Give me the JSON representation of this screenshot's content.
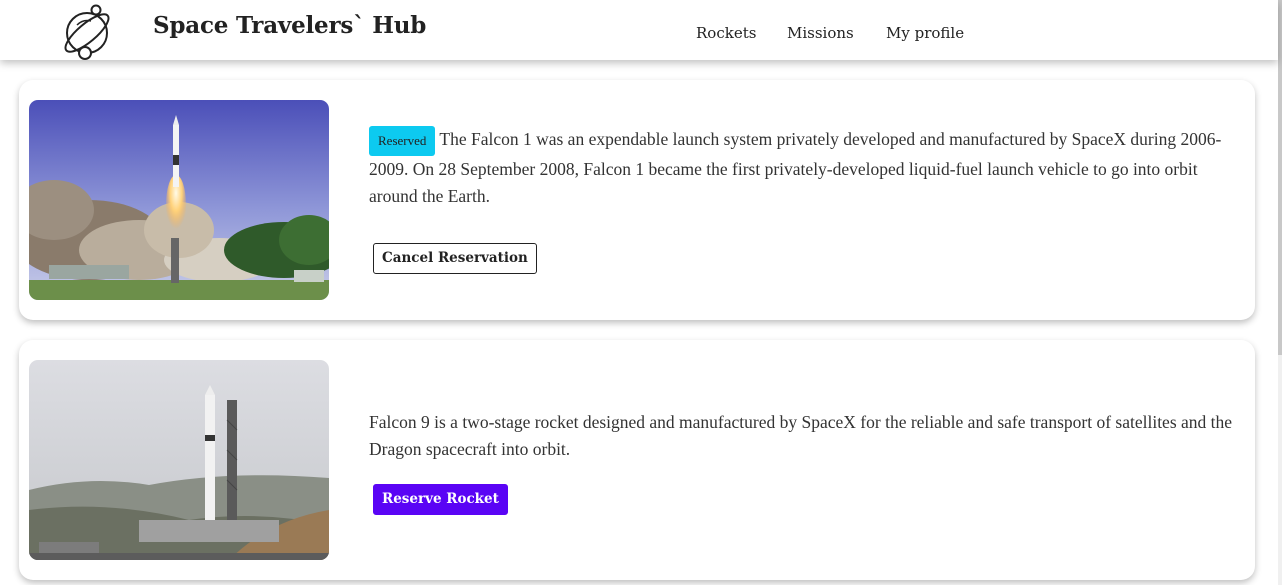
{
  "header": {
    "brand": "Space Travelers` Hub",
    "logo_icon": "planet-logo-icon",
    "nav": [
      {
        "label": "Rockets"
      },
      {
        "label": "Missions"
      },
      {
        "label": "My profile"
      }
    ]
  },
  "rockets": [
    {
      "image": "falcon-1-launch-image",
      "reserved": true,
      "badge": "Reserved",
      "description": "The Falcon 1 was an expendable launch system privately developed and manufactured by SpaceX during 2006-2009. On 28 September 2008, Falcon 1 became the first privately-developed liquid-fuel launch vehicle to go into orbit around the Earth.",
      "button": "Cancel Reservation"
    },
    {
      "image": "falcon-9-pad-image",
      "reserved": false,
      "description": "Falcon 9 is a two-stage rocket designed and manufactured by SpaceX for the reliable and safe transport of satellites and the Dragon spacecraft into orbit.",
      "button": "Reserve Rocket"
    }
  ],
  "colors": {
    "badge": "#0dcaf0",
    "reserve_button": "#5a04f5",
    "text": "#333333"
  }
}
